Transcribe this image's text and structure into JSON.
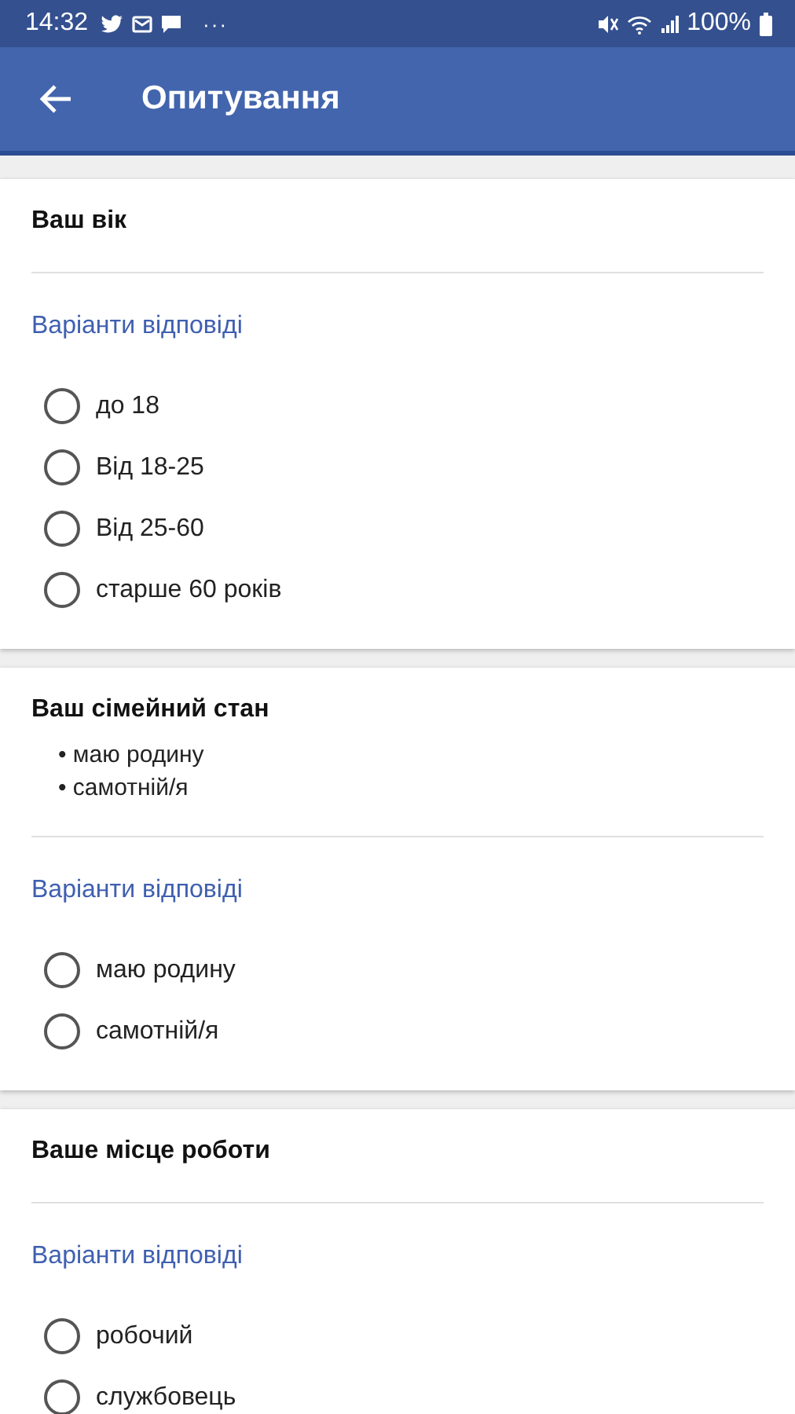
{
  "status_bar": {
    "time": "14:32",
    "notification_more": "···",
    "battery": "100%"
  },
  "app_bar": {
    "title": "Опитування"
  },
  "questions": [
    {
      "title": "Ваш вік",
      "answers_label": "Варіанти відповіді",
      "options": [
        {
          "label": "до 18",
          "selected": false
        },
        {
          "label": "Від 18-25",
          "selected": false
        },
        {
          "label": "Від 25-60",
          "selected": false
        },
        {
          "label": "старше 60 років",
          "selected": false
        }
      ]
    },
    {
      "title": "Ваш сімейний стан",
      "bullets": [
        "• маю родину",
        "• самотній/я"
      ],
      "answers_label": "Варіанти відповіді",
      "options": [
        {
          "label": "маю родину",
          "selected": false
        },
        {
          "label": "самотній/я",
          "selected": false
        }
      ]
    },
    {
      "title": "Ваше місце роботи",
      "answers_label": "Варіанти відповіді",
      "options": [
        {
          "label": "робочий",
          "selected": false
        },
        {
          "label": "службовець",
          "selected": false
        }
      ]
    }
  ]
}
